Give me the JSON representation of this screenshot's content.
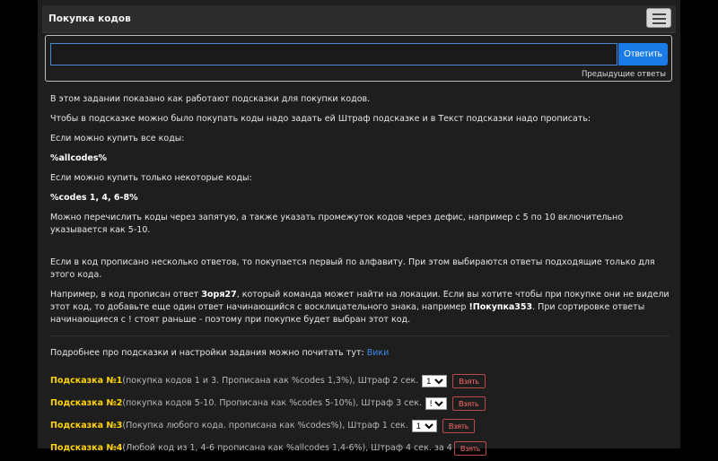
{
  "header": {
    "title": "Покупка кодов"
  },
  "answer": {
    "placeholder": "",
    "submit_label": "Ответить",
    "prev_answers_label": "Предыдущие ответы"
  },
  "content": {
    "intro": "В этом задании показано как работают подсказки для покупки кодов.",
    "p2": "Чтобы в подсказке можно было покупать коды надо задать ей Штраф подсказке и в Текст подсказки надо прописать:",
    "p3": "Если можно купить все коды:",
    "code1": "%allcodes%",
    "p4": "Если можно купить только некоторые коды:",
    "code2": "%codes 1, 4, 6-8%",
    "p5": "Можно перечислить коды через запятую, а также указать промежуток кодов через дефис, например с 5 по 10 включительно указывается как 5-10.",
    "p6": "Если в код прописано несколько ответов, то покупается первый по алфавиту. При этом выбираются ответы подходящие только для этого кода.",
    "p7_a": "Например, в код прописан ответ ",
    "p7_code1": "Зоря27",
    "p7_b": ", который команда может найти на локации. Если вы хотите чтобы при покупке они не видели этот код, то добавьте еще один ответ начинающийся с восклицательного знака, например ",
    "p7_code2": "!Покупка353",
    "p7_c": ". При сортировке ответы начинающиеся с ! стоят раньше - поэтому при покупке будет выбран этот код.",
    "more_text": "Подробнее про подсказки и настройки задания можно почитать тут: ",
    "wiki_label": "Вики"
  },
  "hints": [
    {
      "name": "Подсказка №1",
      "desc": "(покупка кодов 1 и 3. Прописана как %codes 1,3%), Штраф 2 сек.",
      "selected": "1",
      "take_label": "Взять"
    },
    {
      "name": "Подсказка №2",
      "desc": "(покупка кодов 5-10. Прописана как %codes 5-10%), Штраф 3 сек.",
      "selected": "5",
      "take_label": "Взять"
    },
    {
      "name": "Подсказка №3",
      "desc": "(Покупка любого кода. прописана как %codes%), Штраф 1 сек.",
      "selected": "1",
      "take_label": "Взять"
    },
    {
      "name": "Подсказка №4",
      "desc": "(Любой код из 1, 4-6 прописана как %allcodes 1,4-6%), Штраф 4 сек. за 4",
      "selected": null,
      "take_label": "Взять"
    }
  ],
  "colors": {
    "hint_name": "#ffd400",
    "accent": "#1a7ae6",
    "take_button": "#ff6d6d"
  }
}
